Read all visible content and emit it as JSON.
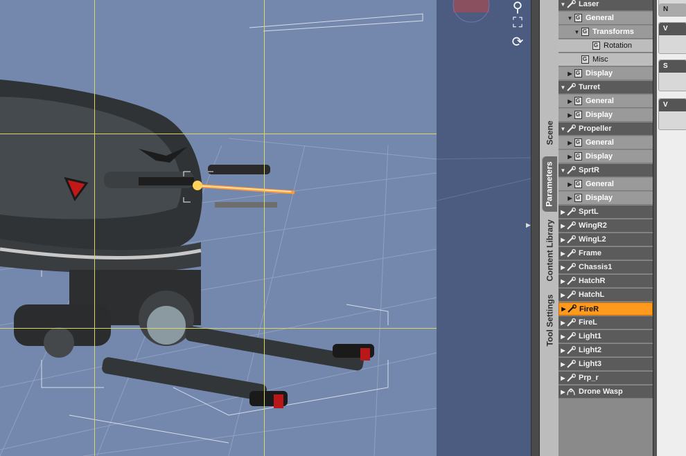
{
  "viewport": {
    "label": "3D Viewport"
  },
  "viewport_icons": [
    "search-icon",
    "frame-icon",
    "orbit-icon"
  ],
  "tabs": [
    {
      "label": "Scene"
    },
    {
      "label": "Parameters"
    },
    {
      "label": "Content Library"
    },
    {
      "label": "Tool Settings"
    }
  ],
  "tree": {
    "rows": [
      {
        "label": "Laser",
        "kind": "node",
        "twirl": "open",
        "level": 0
      },
      {
        "label": "General",
        "kind": "group",
        "twirl": "open",
        "level": 1
      },
      {
        "label": "Transforms",
        "kind": "group",
        "twirl": "open",
        "level": 2
      },
      {
        "label": "Rotation",
        "kind": "prop",
        "twirl": "",
        "level": 3
      },
      {
        "label": "Misc",
        "kind": "prop",
        "twirl": "",
        "level": 2
      },
      {
        "label": "Display",
        "kind": "group",
        "twirl": "closed",
        "level": 1
      },
      {
        "label": "Turret",
        "kind": "node",
        "twirl": "open",
        "level": 0
      },
      {
        "label": "General",
        "kind": "group",
        "twirl": "closed",
        "level": 1
      },
      {
        "label": "Display",
        "kind": "group",
        "twirl": "closed",
        "level": 1
      },
      {
        "label": "Propeller",
        "kind": "node",
        "twirl": "open",
        "level": 0
      },
      {
        "label": "General",
        "kind": "group",
        "twirl": "closed",
        "level": 1
      },
      {
        "label": "Display",
        "kind": "group",
        "twirl": "closed",
        "level": 1
      },
      {
        "label": "SprtR",
        "kind": "node",
        "twirl": "open",
        "level": 0
      },
      {
        "label": "General",
        "kind": "group",
        "twirl": "closed",
        "level": 1
      },
      {
        "label": "Display",
        "kind": "group",
        "twirl": "closed",
        "level": 1
      },
      {
        "label": "SprtL",
        "kind": "node",
        "twirl": "closed",
        "level": 0
      },
      {
        "label": "WingR2",
        "kind": "node",
        "twirl": "closed",
        "level": 0
      },
      {
        "label": "WingL2",
        "kind": "node",
        "twirl": "closed",
        "level": 0
      },
      {
        "label": "Frame",
        "kind": "node",
        "twirl": "closed",
        "level": 0
      },
      {
        "label": "Chassis1",
        "kind": "node",
        "twirl": "closed",
        "level": 0
      },
      {
        "label": "HatchR",
        "kind": "node",
        "twirl": "closed",
        "level": 0
      },
      {
        "label": "HatchL",
        "kind": "node",
        "twirl": "closed",
        "level": 0
      },
      {
        "label": "FireR",
        "kind": "node",
        "twirl": "closed",
        "level": 0,
        "selected": true
      },
      {
        "label": "FireL",
        "kind": "node",
        "twirl": "closed",
        "level": 0
      },
      {
        "label": "Light1",
        "kind": "node",
        "twirl": "closed",
        "level": 0
      },
      {
        "label": "Light2",
        "kind": "node",
        "twirl": "closed",
        "level": 0
      },
      {
        "label": "Light3",
        "kind": "node",
        "twirl": "closed",
        "level": 0
      },
      {
        "label": "Prp_r",
        "kind": "node",
        "twirl": "closed",
        "level": 0
      },
      {
        "label": "Drone Wasp",
        "kind": "figure",
        "twirl": "closed",
        "level": 0
      }
    ]
  },
  "right_panel": {
    "boxes": [
      {
        "label": "N"
      },
      {
        "label": "V"
      },
      {
        "label": "S"
      },
      {
        "label": "V"
      }
    ]
  },
  "colors": {
    "viewport": "#7487ad",
    "selected": "#ff9a1c",
    "node_row": "#5b5b5b"
  }
}
